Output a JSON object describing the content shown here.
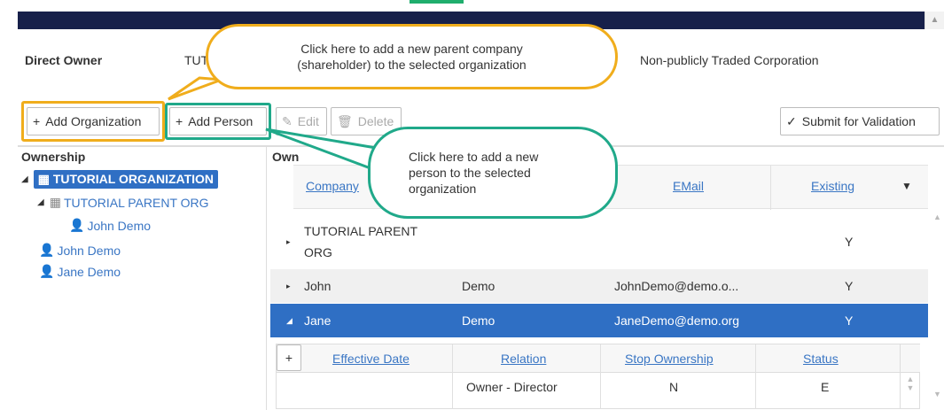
{
  "direct_owner": {
    "label": "Direct Owner",
    "value_partial": "TUT",
    "company_type": "Non-publicly Traded Corporation"
  },
  "toolbar": {
    "add_org": "Add Organization",
    "add_person": "Add Person",
    "edit": "Edit",
    "delete": "Delete",
    "submit": "Submit for Validation"
  },
  "callouts": {
    "org": "Click here to add a new parent company (shareholder) to the selected organization",
    "person": "Click here to add a new person to the selected organization"
  },
  "tree": {
    "header": "Ownership",
    "items": [
      {
        "label": "TUTORIAL ORGANIZATION",
        "type": "org"
      },
      {
        "label": "TUTORIAL PARENT ORG",
        "type": "org"
      },
      {
        "label": "John Demo",
        "type": "person"
      },
      {
        "label": "John Demo",
        "type": "person"
      },
      {
        "label": "Jane Demo",
        "type": "person"
      }
    ]
  },
  "grid": {
    "header_partial": "Own",
    "columns": [
      "Company",
      "EMail",
      "Existing"
    ],
    "rows": [
      {
        "name": "TUTORIAL PARENT ORG",
        "last": "",
        "email": "",
        "existing": "Y"
      },
      {
        "name": "John",
        "last": "Demo",
        "email": "JohnDemo@demo.o...",
        "existing": "Y"
      },
      {
        "name": "Jane",
        "last": "Demo",
        "email": "JaneDemo@demo.org",
        "existing": "Y"
      }
    ],
    "subgrid": {
      "add": "+",
      "columns": [
        "Effective Date",
        "Relation",
        "Stop Ownership",
        "Status"
      ],
      "rows": [
        {
          "effective_date": "",
          "relation": "Owner - Director",
          "stop": "N",
          "status": "E"
        }
      ]
    }
  },
  "colors": {
    "orange": "#f0ad1c",
    "green": "#20a98a",
    "selected": "#2f6fc4",
    "header": "#17204a"
  }
}
